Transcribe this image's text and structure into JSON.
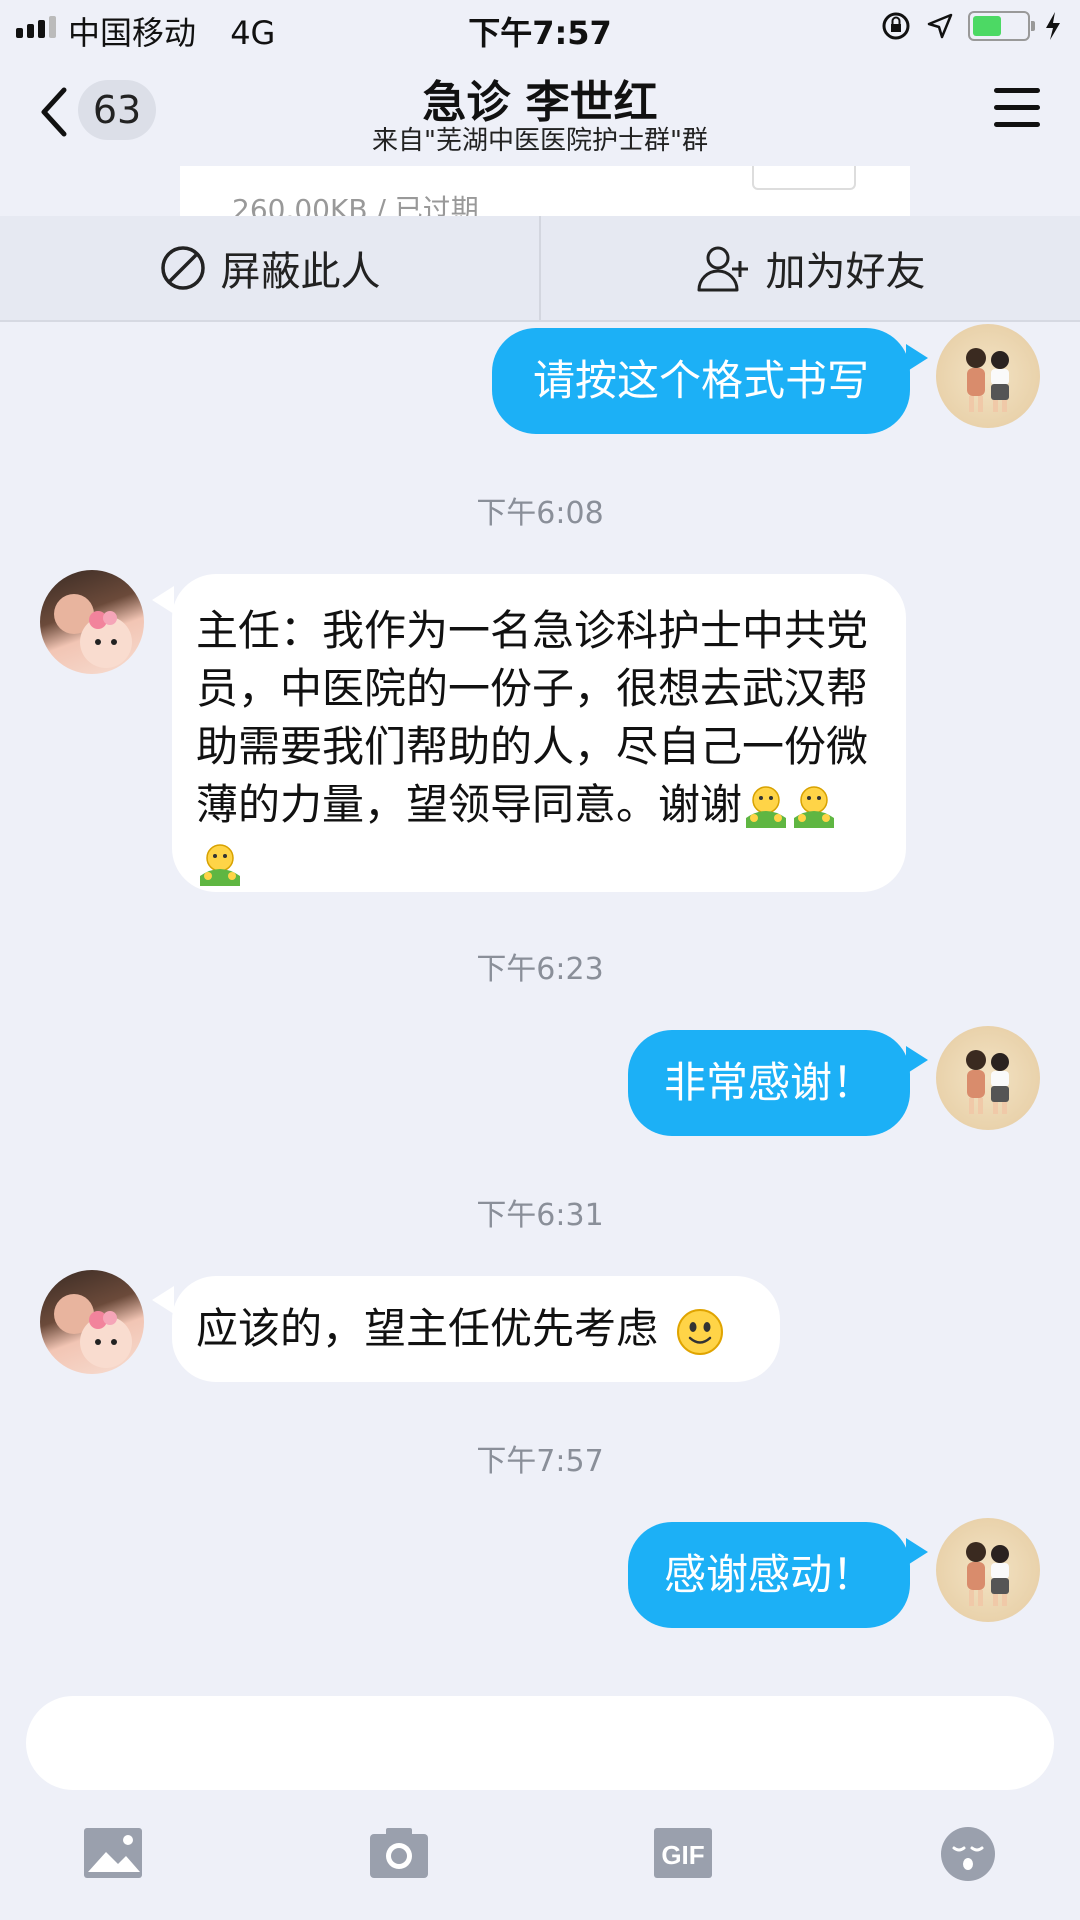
{
  "status_bar": {
    "carrier": "中国移动",
    "network": "4G",
    "time": "下午7:57",
    "battery_level": 0.55,
    "icons": [
      "orientation-lock-icon",
      "location-arrow-icon",
      "battery-icon",
      "charging-bolt-icon"
    ]
  },
  "nav": {
    "back_count": "63",
    "title": "急诊 李世红",
    "subtitle": "来自\"芜湖中医医院护士群\"群"
  },
  "file_card": {
    "meta": "260.00KB / 已过期"
  },
  "actions": {
    "block_label": "屏蔽此人",
    "add_friend_label": "加为好友"
  },
  "messages": [
    {
      "type": "out",
      "text": "请按这个格式书写"
    },
    {
      "type": "time",
      "text": "下午6:08"
    },
    {
      "type": "in",
      "text": "主任：我作为一名急诊科护士中共党员，中医院的一份子，很想去武汉帮助需要我们帮助的人，尽自己一份微薄的力量，望领导同意。谢谢",
      "emoji_count": 3
    },
    {
      "type": "time",
      "text": "下午6:23"
    },
    {
      "type": "out",
      "text": "非常感谢！"
    },
    {
      "type": "time",
      "text": "下午6:31"
    },
    {
      "type": "in",
      "text": "应该的，望主任优先考虑"
    },
    {
      "type": "time",
      "text": "下午7:57"
    },
    {
      "type": "out",
      "text": "感谢感动！"
    }
  ],
  "toolbar": {
    "gif_label": "GIF",
    "icons": [
      "image-icon",
      "camera-icon",
      "gif-icon",
      "emoji-face-icon"
    ]
  },
  "colors": {
    "accent": "#1cb0f6",
    "background": "#eef0f8"
  }
}
